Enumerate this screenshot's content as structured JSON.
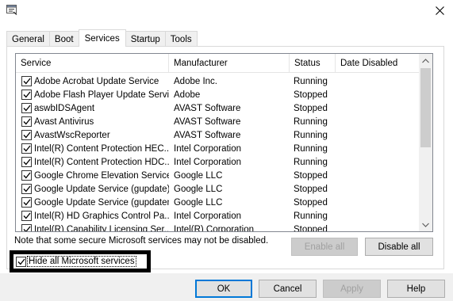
{
  "window": {
    "icon": "msconfig-icon",
    "close": "close-icon"
  },
  "tabs": [
    {
      "label": "General",
      "active": false
    },
    {
      "label": "Boot",
      "active": false
    },
    {
      "label": "Services",
      "active": true
    },
    {
      "label": "Startup",
      "active": false
    },
    {
      "label": "Tools",
      "active": false
    }
  ],
  "services": {
    "columns": [
      "Service",
      "Manufacturer",
      "Status",
      "Date Disabled"
    ],
    "rows": [
      {
        "name": "Adobe Acrobat Update Service",
        "manufacturer": "Adobe Inc.",
        "status": "Running",
        "date_disabled": "",
        "checked": true
      },
      {
        "name": "Adobe Flash Player Update Service",
        "manufacturer": "Adobe",
        "status": "Stopped",
        "date_disabled": "",
        "checked": true
      },
      {
        "name": "aswbIDSAgent",
        "manufacturer": "AVAST Software",
        "status": "Stopped",
        "date_disabled": "",
        "checked": true
      },
      {
        "name": "Avast Antivirus",
        "manufacturer": "AVAST Software",
        "status": "Running",
        "date_disabled": "",
        "checked": true
      },
      {
        "name": "AvastWscReporter",
        "manufacturer": "AVAST Software",
        "status": "Running",
        "date_disabled": "",
        "checked": true
      },
      {
        "name": "Intel(R) Content Protection HEC...",
        "manufacturer": "Intel Corporation",
        "status": "Running",
        "date_disabled": "",
        "checked": true
      },
      {
        "name": "Intel(R) Content Protection HDC...",
        "manufacturer": "Intel Corporation",
        "status": "Running",
        "date_disabled": "",
        "checked": true
      },
      {
        "name": "Google Chrome Elevation Service",
        "manufacturer": "Google LLC",
        "status": "Stopped",
        "date_disabled": "",
        "checked": true
      },
      {
        "name": "Google Update Service (gupdate)",
        "manufacturer": "Google LLC",
        "status": "Stopped",
        "date_disabled": "",
        "checked": true
      },
      {
        "name": "Google Update Service (gupdatem)",
        "manufacturer": "Google LLC",
        "status": "Stopped",
        "date_disabled": "",
        "checked": true
      },
      {
        "name": "Intel(R) HD Graphics Control Pa...",
        "manufacturer": "Intel Corporation",
        "status": "Running",
        "date_disabled": "",
        "checked": true
      },
      {
        "name": "Intel(R) Capability Licensing Ser...",
        "manufacturer": "Intel(R) Corporation",
        "status": "Stopped",
        "date_disabled": "",
        "checked": true
      }
    ]
  },
  "note": "Note that some secure Microsoft services may not be disabled.",
  "buttons": {
    "enable_all": "Enable all",
    "disable_all": "Disable all",
    "ok": "OK",
    "cancel": "Cancel",
    "apply": "Apply",
    "help": "Help"
  },
  "hide_microsoft": {
    "label": "Hide all Microsoft services",
    "checked": true
  },
  "colors": {
    "focus_border": "#0078d7",
    "disabled_text": "#a0a0a0",
    "footer_bg": "#f0f0f0"
  }
}
